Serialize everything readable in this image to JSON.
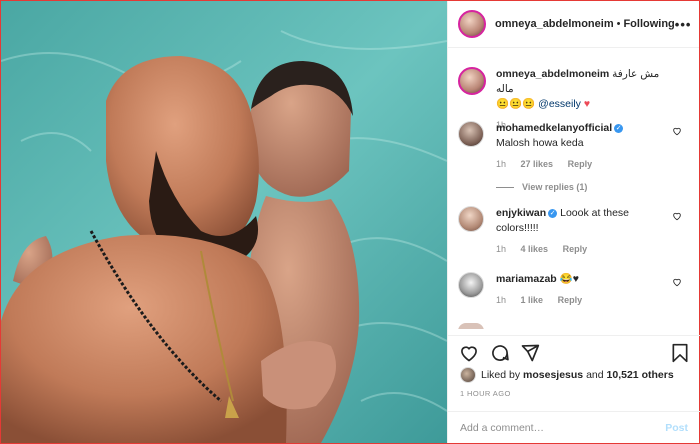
{
  "header": {
    "username": "omneya_abdelmoneim",
    "separator": "•",
    "follow_status": "Following",
    "more": "•••"
  },
  "caption": {
    "username": "omneya_abdelmoneim",
    "text": "مش عارفة ماله",
    "emoji": "😐😐😐",
    "mention": "@esseily",
    "heart": "♥",
    "time": "1h"
  },
  "comments": [
    {
      "username": "mohamedkelanyofficial",
      "verified": true,
      "text": "Malosh howa keda",
      "time": "1h",
      "likes": "27 likes",
      "reply": "Reply",
      "view_replies": "View replies (1)"
    },
    {
      "username": "enjykiwan",
      "verified": true,
      "text": "Loook at these colors!!!!!",
      "time": "1h",
      "likes": "4 likes",
      "reply": "Reply"
    },
    {
      "username": "mariamazab",
      "verified": false,
      "text": "😂♥",
      "time": "1h",
      "likes": "1 like",
      "reply": "Reply"
    }
  ],
  "actions": [
    "heart-icon",
    "comment-icon",
    "share-icon",
    "bookmark-icon"
  ],
  "likes": {
    "prefix": "Liked by",
    "user": "mosesjesus",
    "and": "and",
    "others": "10,521 others"
  },
  "timestamp": "1 HOUR AGO",
  "comment_box": {
    "placeholder": "Add a comment…",
    "post_label": "Post"
  },
  "colors": {
    "text": "#262626",
    "muted": "#8e8e8e",
    "verified": "#3897f0",
    "link": "#00376b",
    "post_disabled": "#b2dffc",
    "heart_red": "#ed4956",
    "frame": "#e53935"
  }
}
